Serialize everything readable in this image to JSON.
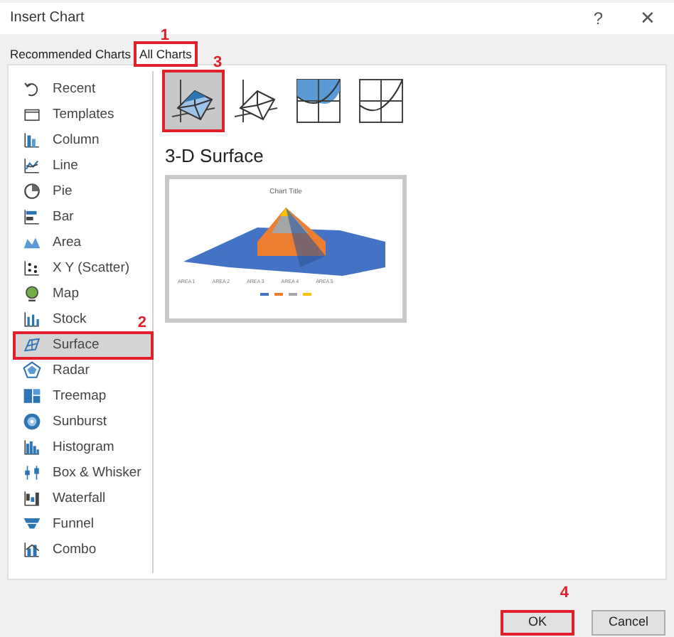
{
  "window": {
    "title": "Insert Chart",
    "help": "?",
    "close": "✕"
  },
  "tabs": [
    {
      "label": "Recommended Charts",
      "selected": false
    },
    {
      "label": "All Charts",
      "selected": true,
      "annotation": "1"
    }
  ],
  "sidebar": {
    "items": [
      {
        "label": "Recent",
        "selected": false
      },
      {
        "label": "Templates",
        "selected": false
      },
      {
        "label": "Column",
        "selected": false
      },
      {
        "label": "Line",
        "selected": false
      },
      {
        "label": "Pie",
        "selected": false
      },
      {
        "label": "Bar",
        "selected": false
      },
      {
        "label": "Area",
        "selected": false
      },
      {
        "label": "X Y (Scatter)",
        "selected": false
      },
      {
        "label": "Map",
        "selected": false
      },
      {
        "label": "Stock",
        "selected": false
      },
      {
        "label": "Surface",
        "selected": true,
        "annotation": "2"
      },
      {
        "label": "Radar",
        "selected": false
      },
      {
        "label": "Treemap",
        "selected": false
      },
      {
        "label": "Sunburst",
        "selected": false
      },
      {
        "label": "Histogram",
        "selected": false
      },
      {
        "label": "Box & Whisker",
        "selected": false
      },
      {
        "label": "Waterfall",
        "selected": false
      },
      {
        "label": "Funnel",
        "selected": false
      },
      {
        "label": "Combo",
        "selected": false
      }
    ]
  },
  "subtypes": [
    {
      "selected": true,
      "annotation": "3"
    },
    {
      "selected": false
    },
    {
      "selected": false
    },
    {
      "selected": false
    }
  ],
  "subtype_title": "3-D Surface",
  "preview": {
    "title": "Chart Title",
    "categories": [
      "AREA 1",
      "AREA 2",
      "AREA 3",
      "AREA 4",
      "AREA 5"
    ]
  },
  "buttons": [
    {
      "label": "OK",
      "annotation": "4"
    },
    {
      "label": "Cancel"
    }
  ]
}
